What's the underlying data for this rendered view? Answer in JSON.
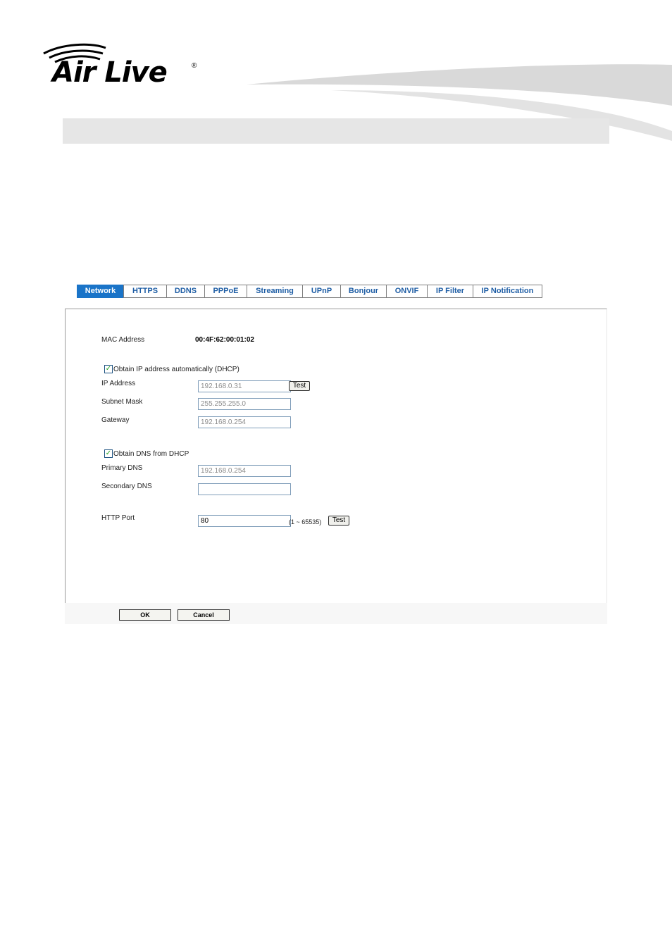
{
  "brand": {
    "logo_text": "Air Live",
    "registered_mark": "®"
  },
  "tabs": [
    {
      "label": "Network",
      "active": true
    },
    {
      "label": "HTTPS"
    },
    {
      "label": "DDNS"
    },
    {
      "label": "PPPoE"
    },
    {
      "label": "Streaming"
    },
    {
      "label": "UPnP"
    },
    {
      "label": "Bonjour"
    },
    {
      "label": "ONVIF"
    },
    {
      "label": "IP Filter"
    },
    {
      "label": "IP Notification"
    }
  ],
  "network": {
    "mac_label": "MAC Address",
    "mac_value": "00:4F:62:00:01:02",
    "dhcp_checkbox_label": "Obtain IP address automatically (DHCP)",
    "dhcp_checked": true,
    "ip_label": "IP Address",
    "ip_value": "192.168.0.31",
    "ip_test_label": "Test",
    "subnet_label": "Subnet Mask",
    "subnet_value": "255.255.255.0",
    "gateway_label": "Gateway",
    "gateway_value": "192.168.0.254",
    "dns_checkbox_label": "Obtain DNS from DHCP",
    "dns_checked": true,
    "primary_dns_label": "Primary DNS",
    "primary_dns_value": "192.168.0.254",
    "secondary_dns_label": "Secondary DNS",
    "secondary_dns_value": "",
    "http_port_label": "HTTP Port",
    "http_port_value": "80",
    "http_port_range": "(1 ~ 65535)",
    "http_test_label": "Test"
  },
  "actions": {
    "ok_label": "OK",
    "cancel_label": "Cancel"
  },
  "colors": {
    "tab_active_bg": "#1a74c8",
    "tab_text": "#1f5ea5",
    "header_bar": "#e6e6e6",
    "checkbox_tick": "#21a121"
  }
}
